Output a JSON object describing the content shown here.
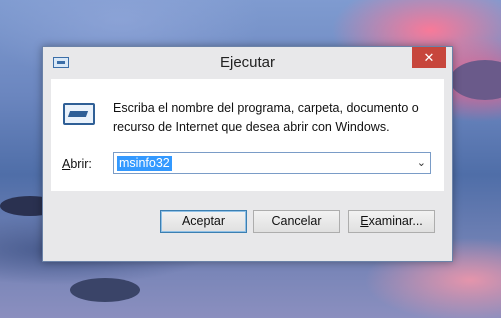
{
  "window": {
    "title": "Ejecutar",
    "close_label": "✕"
  },
  "dialog": {
    "description_line1": "Escriba el nombre del programa, carpeta, documento o",
    "description_line2": "recurso de Internet que desea abrir con Windows.",
    "open_label_mnemonic": "A",
    "open_label_rest": "brir:",
    "open_value": "msinfo32",
    "dropdown_arrow": "⌄"
  },
  "buttons": {
    "accept": "Aceptar",
    "cancel": "Cancelar",
    "browse_mnemonic": "E",
    "browse_rest": "xaminar..."
  },
  "colors": {
    "close_button": "#c7463c",
    "selection": "#3399ff",
    "default_button_border": "#3c7fb1"
  },
  "icons": {
    "title": "run-dialog-icon",
    "content": "run-program-icon",
    "dropdown": "chevron-down-icon"
  }
}
